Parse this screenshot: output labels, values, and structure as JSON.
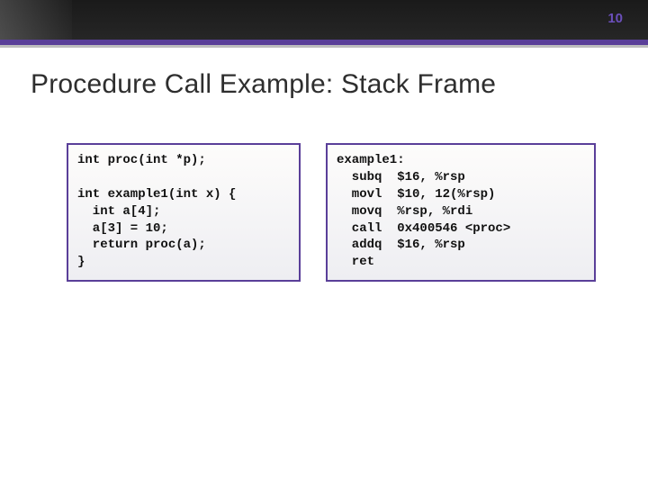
{
  "page_number": "10",
  "title": "Procedure Call Example: Stack Frame",
  "c_code": "int proc(int *p);\n\nint example1(int x) {\n  int a[4];\n  a[3] = 10;\n  return proc(a);\n}",
  "asm_code": "example1:\n  subq  $16, %rsp\n  movl  $10, 12(%rsp)\n  movq  %rsp, %rdi\n  call  0x400546 <proc>\n  addq  $16, %rsp\n  ret"
}
